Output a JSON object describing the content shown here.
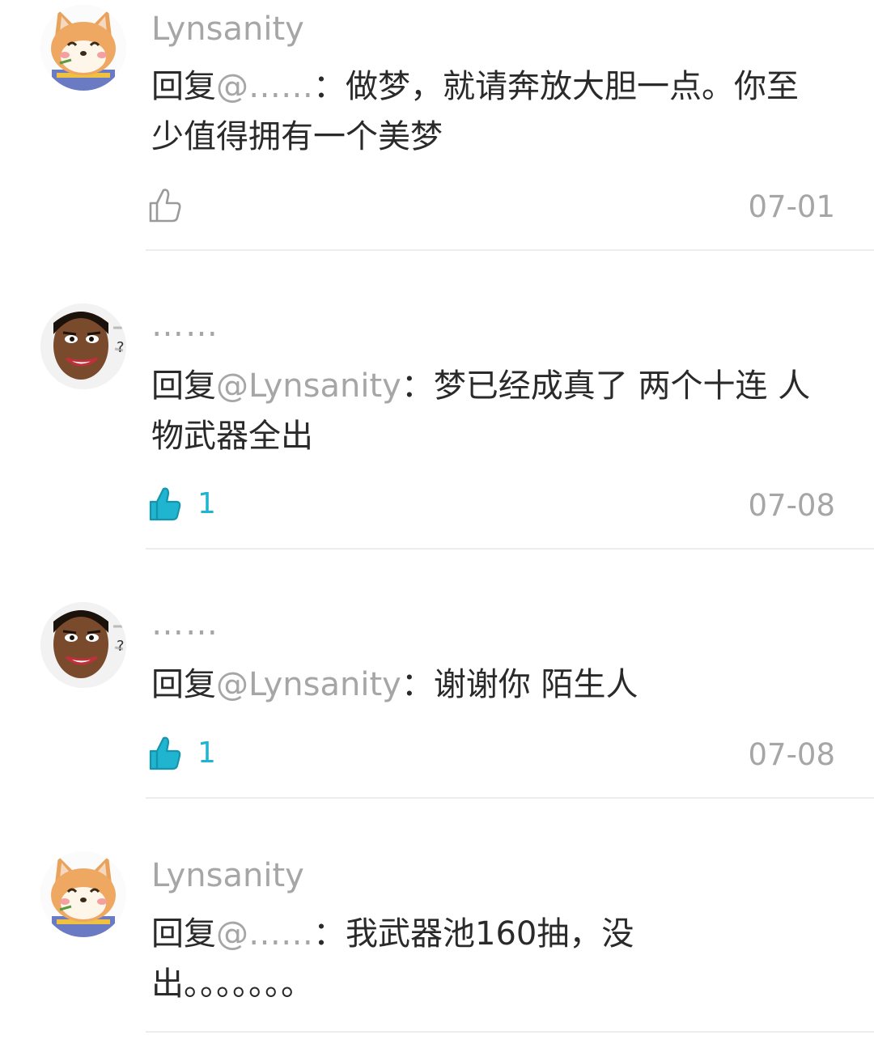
{
  "comments": [
    {
      "avatar_icon": "shiba-dog-avatar-icon",
      "username": "Lynsanity",
      "reply_prefix": "回复",
      "mention": "@……",
      "colon": "：",
      "text_line1": "做梦，就请奔放大胆一点。你至",
      "text_line2": "少值得拥有一个美梦",
      "liked": false,
      "like_count": "",
      "date": "07-01"
    },
    {
      "avatar_icon": "meme-man-avatar-icon",
      "username": "……",
      "reply_prefix": "回复",
      "mention": "@Lynsanity",
      "colon": "：",
      "text_line1": "梦已经成真了 两个十连 人",
      "text_line2": "物武器全出",
      "liked": true,
      "like_count": "1",
      "date": "07-08"
    },
    {
      "avatar_icon": "meme-man-avatar-icon",
      "username": "……",
      "reply_prefix": "回复",
      "mention": "@Lynsanity",
      "colon": "：",
      "text_line1": "谢谢你 陌生人",
      "liked": true,
      "like_count": "1",
      "date": "07-08"
    },
    {
      "avatar_icon": "shiba-dog-avatar-icon",
      "username": "Lynsanity",
      "reply_prefix": "回复",
      "mention": "@……",
      "colon": "：",
      "text_line1": "我武器池160抽，没",
      "text_line2": "出。。。。。。。"
    }
  ],
  "colors": {
    "accent": "#1fb4cf",
    "muted_text": "#a6a6a6",
    "body_text": "#2a2a2a",
    "divider": "#ececec"
  }
}
